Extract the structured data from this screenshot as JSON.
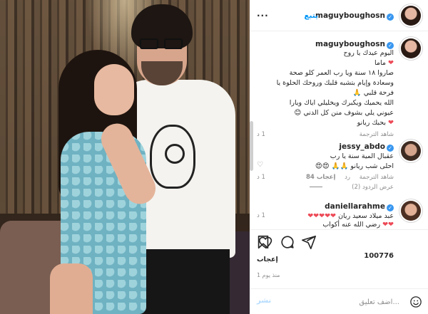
{
  "post": {
    "author": "maguyboughosn",
    "follow_label": "يتبع",
    "more_label": "...",
    "caption_lines": [
      "اليوم عيدك يا روح",
      "ماما",
      "صاروا ١٨ سنة ويا رب العمر كلو صحة",
      "وسعادة وإيام بتشبه قلبك وروحك الحلوة يا",
      "فرحة قلبي",
      "الله يحميك ويكبرك ويخليلي اياك ويارا",
      "عيوني يلي بشوف منن كل الدني",
      "بحبك ريانو"
    ],
    "caption_meta": {
      "translation": "شاهد الترجمة",
      "age": "1 د"
    }
  },
  "comments": [
    {
      "username": "jessy_abdo",
      "lines": [
        "عقبال المية سنة يا رب",
        "احلى شب ريانو"
      ],
      "translation": "شاهد الترجمة",
      "likes": "إعجاب 84",
      "reply": "رد",
      "age": "1 د",
      "view_replies": "عرض الردود (2)"
    },
    {
      "username": "daniellarahme",
      "lines": [
        "عبد ميلاد سعيد ريان",
        "رضي الله عنه أكواب"
      ],
      "age": "1 د"
    }
  ],
  "stats": {
    "likes_count": "100776",
    "likes_label": "إعجاب",
    "posted": "منذ يوم 1"
  },
  "comment_box": {
    "placeholder": "...اضف تعليق",
    "post_label": "نشر"
  },
  "icons": {
    "like": "heart-icon",
    "comment": "comment-icon",
    "share": "share-icon",
    "save": "bookmark-icon",
    "emoji": "emoji-icon",
    "verified": "verified-badge-icon"
  },
  "colors": {
    "accent": "#0095f6",
    "verified": "#3897f0",
    "heart": "#ed4956",
    "muted": "#8e8e8e"
  }
}
